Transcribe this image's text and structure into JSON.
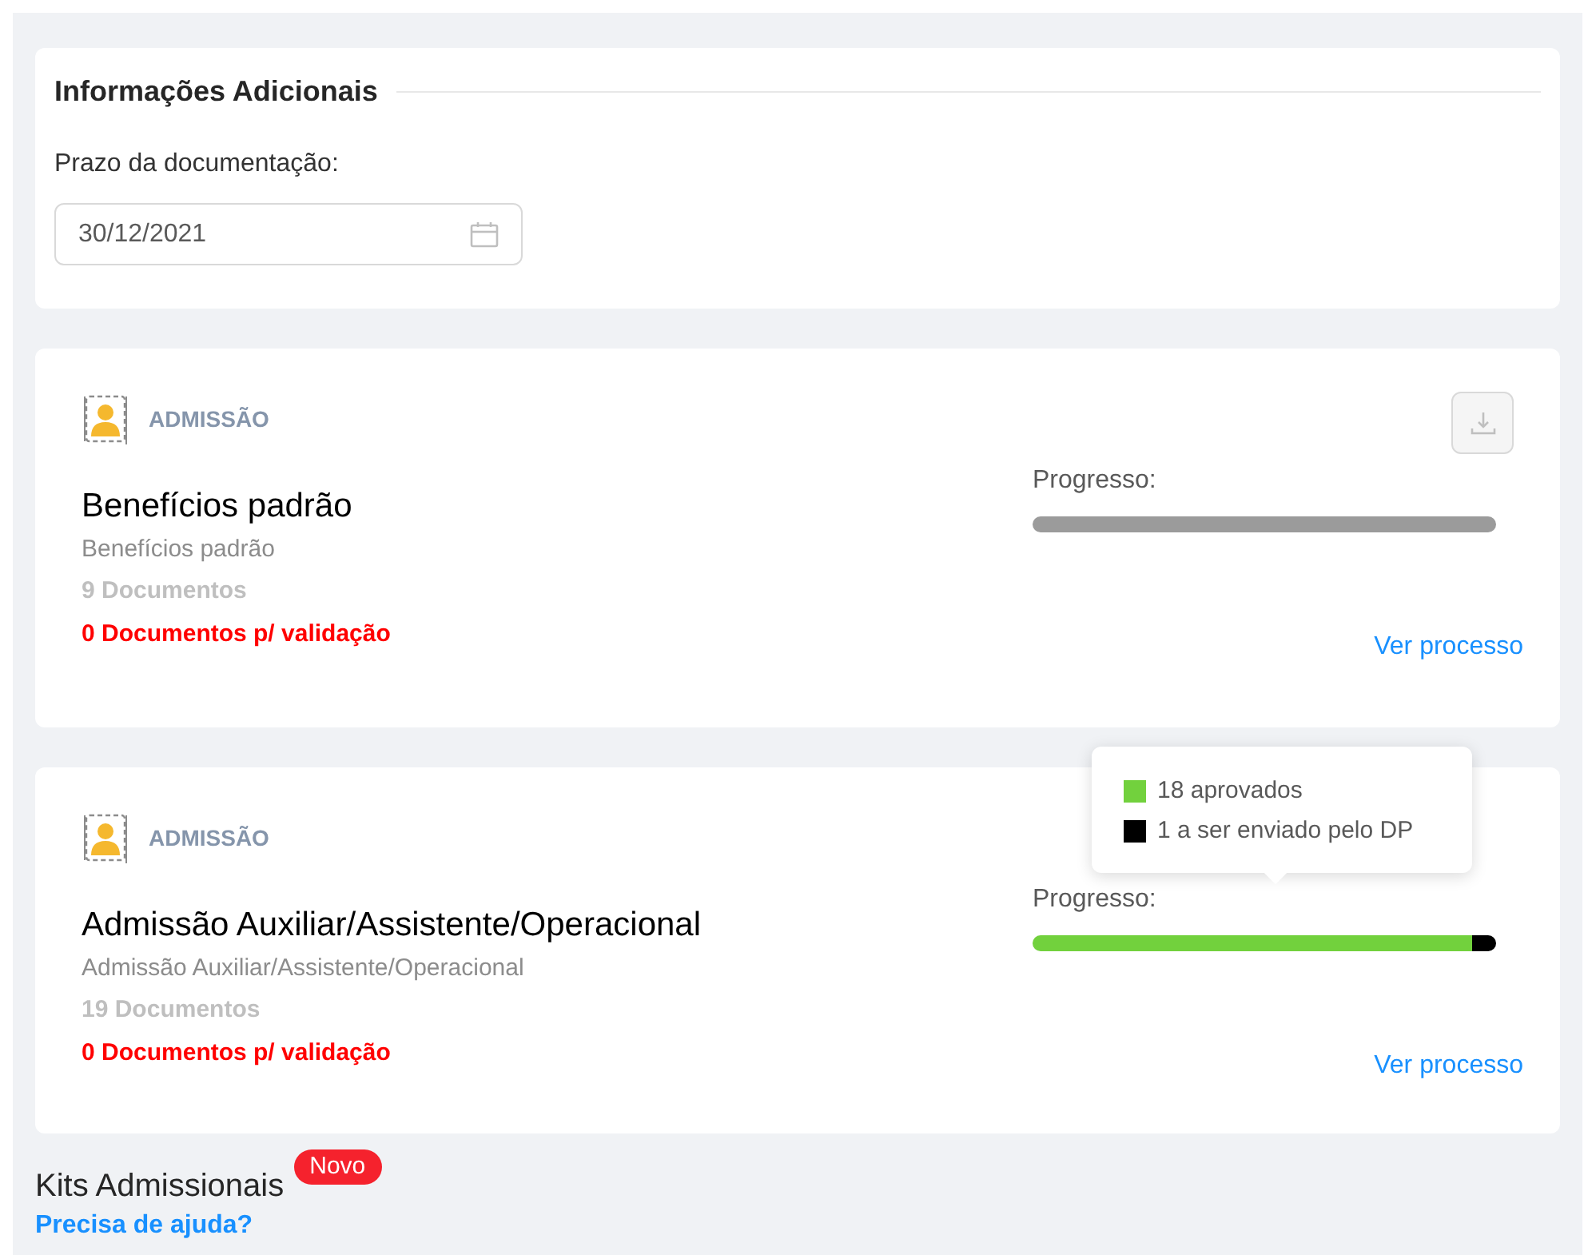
{
  "additional_info": {
    "title": "Informações Adicionais",
    "deadline_label": "Prazo da documentação:",
    "deadline_value": "30/12/2021"
  },
  "processes": [
    {
      "category": "ADMISSÃO",
      "title": "Benefícios padrão",
      "subtitle": "Benefícios padrão",
      "documents": "9 Documentos",
      "pending": "0 Documentos p/ validação",
      "download": true,
      "progress_label": "Progresso:",
      "segments": [
        {
          "color": "#9b9b9b",
          "level": 1
        }
      ],
      "link": "Ver processo"
    },
    {
      "category": "ADMISSÃO",
      "title": "Admissão Auxiliar/Assistente/Operacional",
      "subtitle": "Admissão Auxiliar/Assistente/Operacional",
      "documents": "19 Documentos",
      "pending": "0 Documentos p/ validação",
      "download": false,
      "progress_label": "Progresso:",
      "segments": [
        {
          "color": "#72d13d",
          "level": 0.947
        },
        {
          "color": "#000000",
          "level": 0.053
        }
      ],
      "tooltip": [
        {
          "color": "#72d13d",
          "text": "18 aprovados"
        },
        {
          "color": "#000000",
          "text": "1 a ser enviado pelo DP"
        }
      ],
      "link": "Ver processo"
    }
  ],
  "kits": {
    "title": "Kits Admissionais",
    "badge": "Novo",
    "help_link": "Precisa de ajuda?"
  }
}
